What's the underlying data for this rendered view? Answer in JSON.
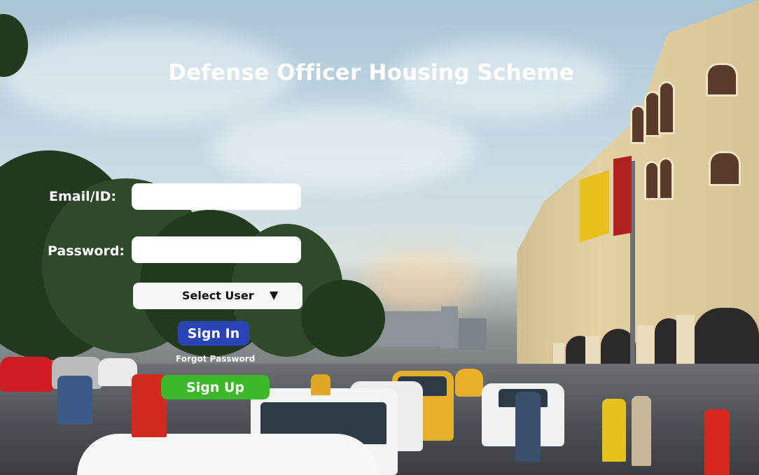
{
  "header": {
    "title": "Defense Officer Housing Scheme"
  },
  "form": {
    "email_label": "Email/ID:",
    "email_value": "",
    "password_label": "Password:",
    "password_value": "",
    "user_select_label": "Select User",
    "user_select_caret": "▼",
    "signin_label": "Sign In",
    "forgot_label": "Forgot Password",
    "signup_label": "Sign Up"
  },
  "colors": {
    "signin_button": "#2a44b8",
    "signup_button": "#3cb82a",
    "title_text": "#ffffff"
  }
}
